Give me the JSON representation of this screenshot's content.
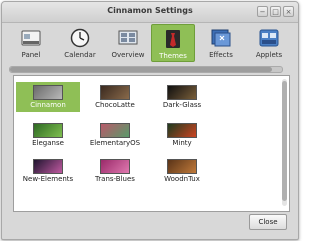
{
  "window": {
    "title": "Cinnamon Settings",
    "controls": [
      "−",
      "□",
      "×"
    ]
  },
  "toolbar": {
    "items": [
      {
        "label": "Panel",
        "icon": "panel-icon",
        "active": false
      },
      {
        "label": "Calendar",
        "icon": "clock-icon",
        "active": false
      },
      {
        "label": "Overview",
        "icon": "overview-icon",
        "active": false
      },
      {
        "label": "Themes",
        "icon": "themes-icon",
        "active": true
      },
      {
        "label": "Effects",
        "icon": "effects-icon",
        "active": false
      },
      {
        "label": "Applets",
        "icon": "applets-icon",
        "active": false
      }
    ]
  },
  "themes": {
    "selected": "Cinnamon",
    "items": [
      {
        "label": "Cinnamon",
        "colors": [
          "#6b6b6b",
          "#b9b9b9"
        ]
      },
      {
        "label": "ChocoLatte",
        "colors": [
          "#3a2a20",
          "#8a6a4a"
        ]
      },
      {
        "label": "Dark-Glass",
        "colors": [
          "#101010",
          "#7a5f3a"
        ]
      },
      {
        "label": "Eleganse",
        "colors": [
          "#2f6a24",
          "#7fbf4f"
        ]
      },
      {
        "label": "ElementaryOS",
        "colors": [
          "#b85a6a",
          "#5a9a6a"
        ]
      },
      {
        "label": "Minty",
        "colors": [
          "#1e3a1e",
          "#cc4422"
        ]
      },
      {
        "label": "New-Elements",
        "colors": [
          "#201530",
          "#c05aa0"
        ]
      },
      {
        "label": "Trans-Blues",
        "colors": [
          "#9a2a6a",
          "#e07ab0"
        ]
      },
      {
        "label": "WoodnTux",
        "colors": [
          "#5a3418",
          "#c07a3a"
        ]
      }
    ]
  },
  "footer": {
    "close_label": "Close"
  }
}
